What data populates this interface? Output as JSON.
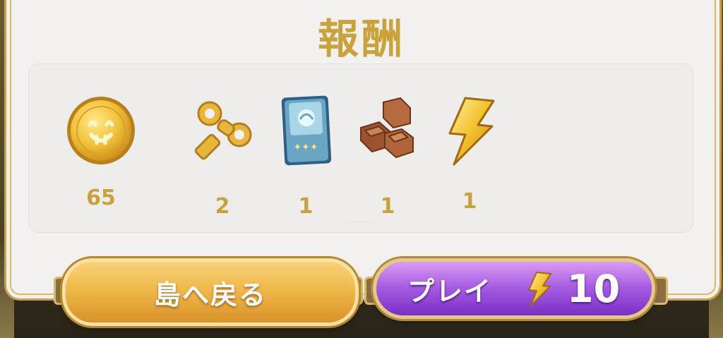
{
  "title": "報酬",
  "rewards": [
    {
      "icon": "gold-coin-icon",
      "qty": "65"
    },
    {
      "icon": "wind-up-key-icon",
      "qty": "2"
    },
    {
      "icon": "card-pack-icon",
      "qty": "1"
    },
    {
      "icon": "brown-blocks-icon",
      "qty": "1"
    },
    {
      "icon": "lightning-bolt-icon",
      "qty": "1"
    }
  ],
  "buttons": {
    "back_label": "島へ戻る",
    "play_label": "プレイ",
    "play_cost": "10",
    "play_cost_icon": "lightning-bolt-icon"
  },
  "colors": {
    "accent_gold": "#c9a23a",
    "back_button": "#f0b84a",
    "play_button": "#a45ae0"
  }
}
